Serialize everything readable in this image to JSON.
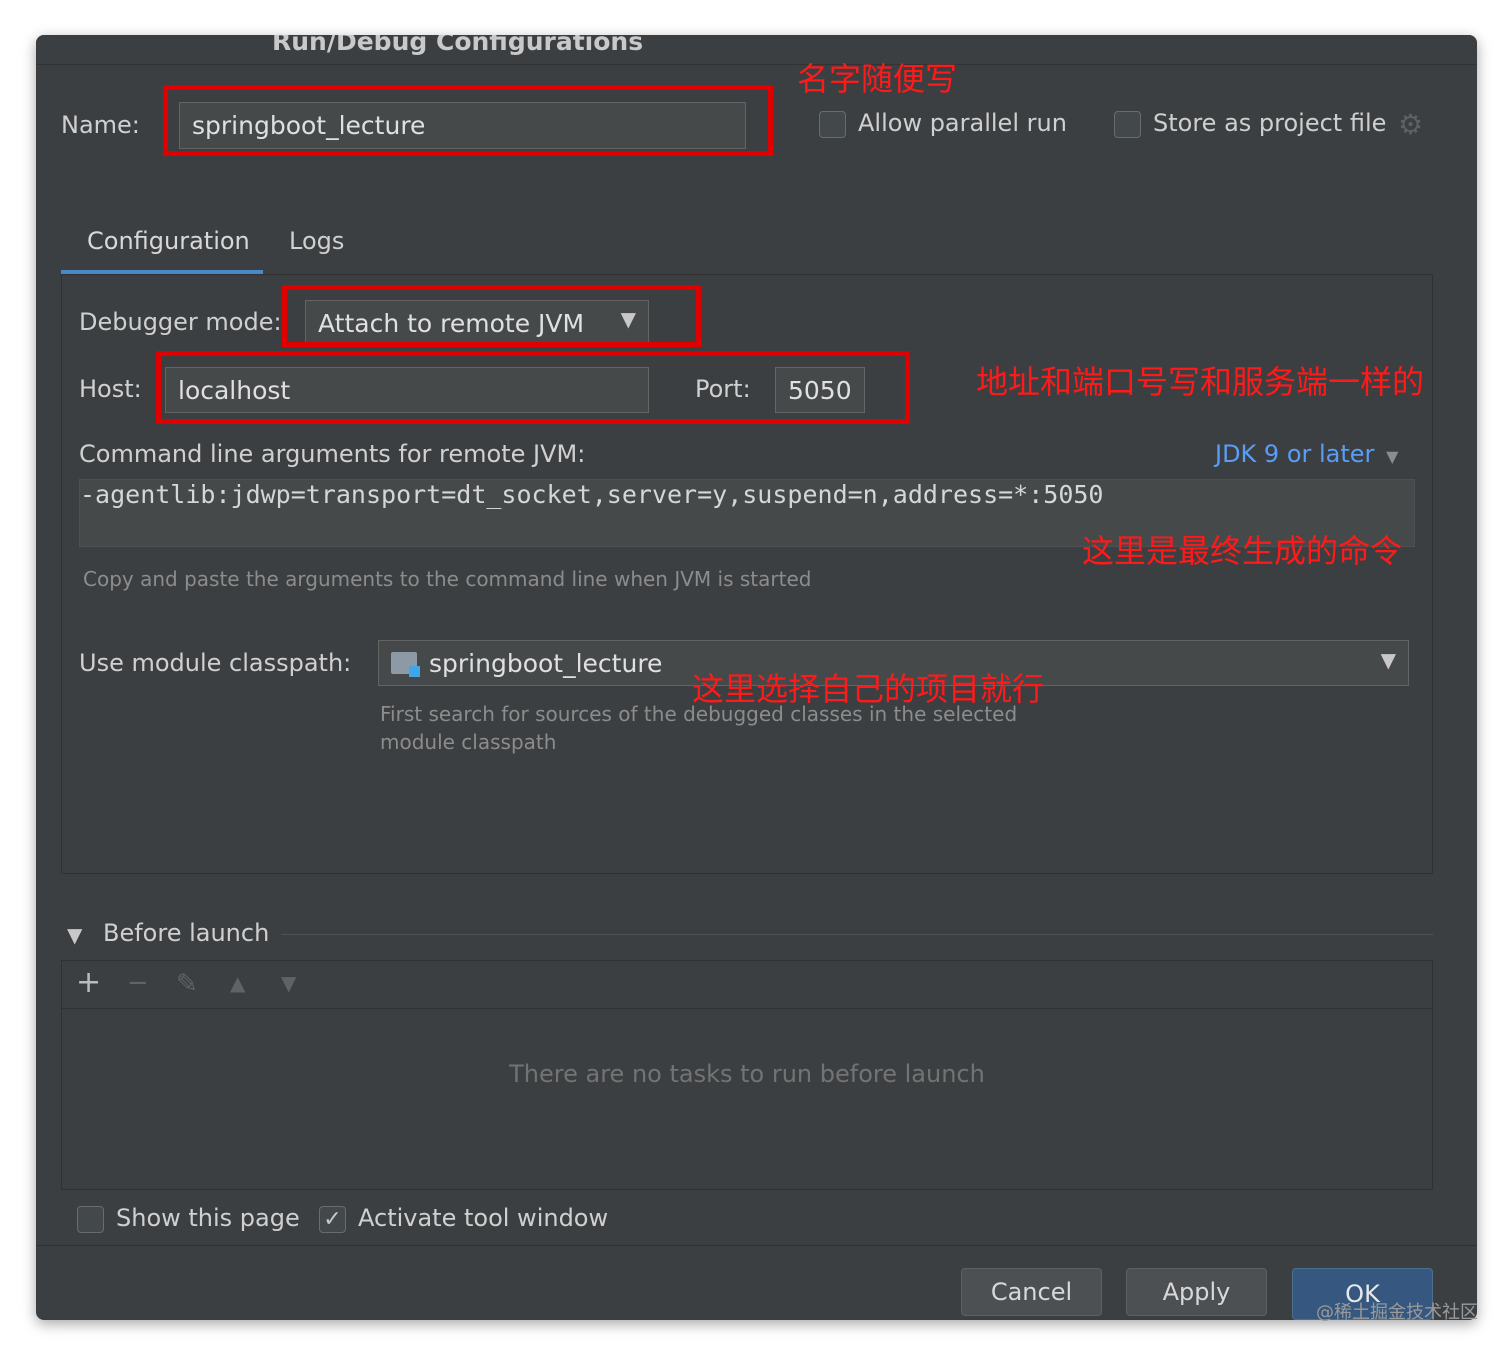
{
  "window": {
    "title": "Run/Debug Configurations"
  },
  "name": {
    "label": "Name:",
    "value": "springboot_lecture"
  },
  "options": {
    "allow_parallel": "Allow parallel run",
    "store_as_file": "Store as project file"
  },
  "tabs": [
    {
      "label": "Configuration",
      "active": true
    },
    {
      "label": "Logs",
      "active": false
    }
  ],
  "config": {
    "debugger_mode_label": "Debugger mode:",
    "debugger_mode_value": "Attach to remote JVM",
    "host_label": "Host:",
    "host_value": "localhost",
    "port_label": "Port:",
    "port_value": "5050",
    "cmd_label": "Command line arguments for remote JVM:",
    "jdk_link": "JDK 9 or later",
    "cmd_value": "-agentlib:jdwp=transport=dt_socket,server=y,suspend=n,address=*:5050",
    "cmd_hint": "Copy and paste the arguments to the command line when JVM is started",
    "module_label": "Use module classpath:",
    "module_value": "springboot_lecture",
    "module_hint_1": "First search for sources of the debugged classes in the selected",
    "module_hint_2": "module classpath"
  },
  "before_launch": {
    "title": "Before launch",
    "empty": "There are no tasks to run before launch"
  },
  "footer": {
    "show_page": "Show this page",
    "activate_tool": "Activate tool window",
    "cancel": "Cancel",
    "apply": "Apply",
    "ok": "OK"
  },
  "annotations": {
    "name_note": "名字随便写",
    "host_note": "地址和端口号写和服务端一样的",
    "cmd_note": "这里是最终生成的命令",
    "module_note": "这里选择自己的项目就行"
  },
  "watermark": "@稀土掘金技术社区",
  "colors": {
    "accent": "#4a88c7",
    "annotation": "#e00000",
    "link": "#589df6"
  }
}
